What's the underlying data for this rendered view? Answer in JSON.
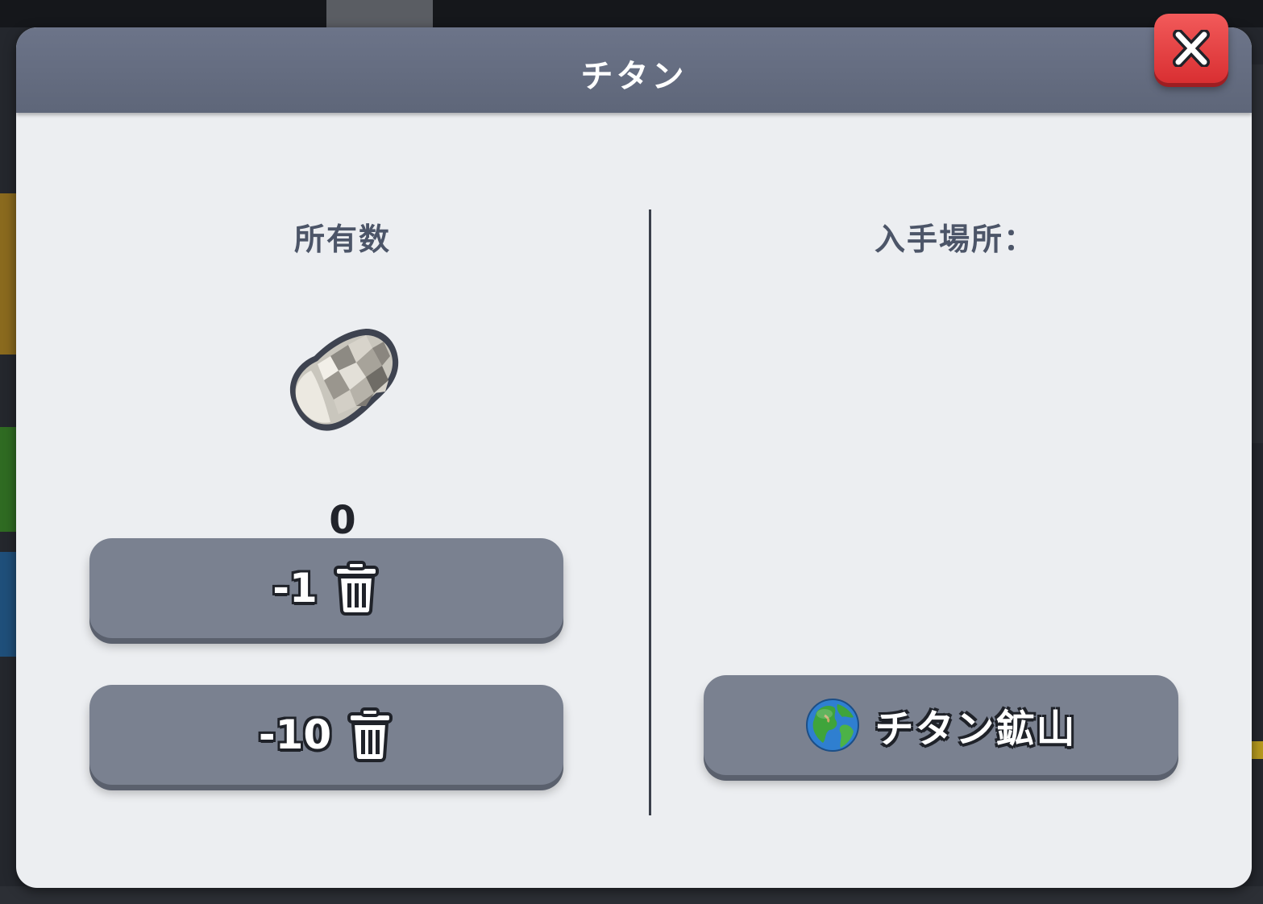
{
  "dialog": {
    "title": "チタン",
    "close_icon": "close-icon"
  },
  "owned": {
    "heading": "所有数",
    "item_icon": "titanium-ore-icon",
    "count": "0",
    "buttons": [
      {
        "label": "-1",
        "icon": "trash-icon"
      },
      {
        "label": "-10",
        "icon": "trash-icon"
      }
    ]
  },
  "source": {
    "heading": "入手場所：",
    "locations": [
      {
        "label": "チタン鉱山",
        "icon": "globe-icon"
      }
    ]
  },
  "colors": {
    "header": "#646c80",
    "panel": "#eceef1",
    "button": "#7a8190",
    "close": "#e53a3d",
    "heading_text": "#4c5568"
  }
}
